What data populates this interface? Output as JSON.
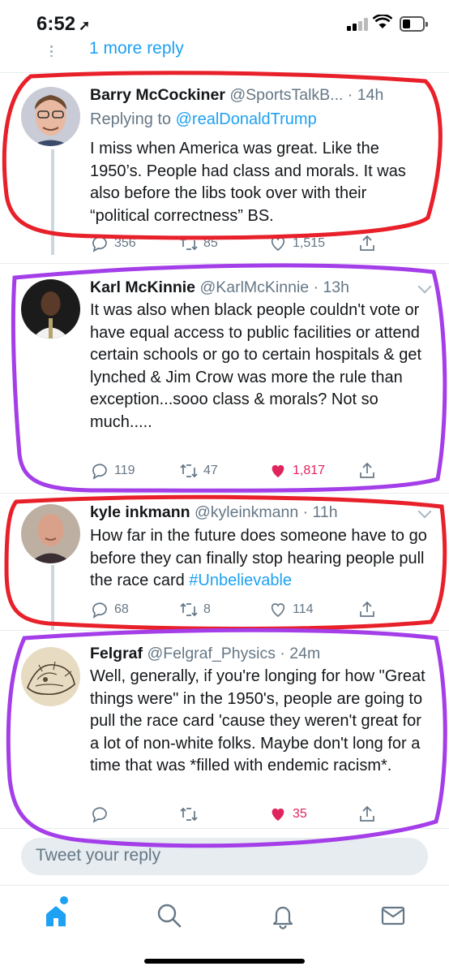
{
  "status_bar": {
    "time": "6:52",
    "location_arrow": "location-arrow-icon"
  },
  "thread": {
    "more_replies": "1 more reply"
  },
  "tweets": [
    {
      "name": "Barry McCockiner",
      "handle": "@SportsTalkB...",
      "time": "· 14h",
      "replying_prefix": "Replying to ",
      "replying_to": "@realDonaldTrump",
      "text": "I miss when America was great. Like the 1950’s. People had class and morals. It was also before the libs took over with their “political correctness” BS.",
      "replies": "356",
      "retweets": "85",
      "likes": "1,515",
      "liked": false
    },
    {
      "name": "Karl McKinnie",
      "handle": "@KarlMcKinnie",
      "time": "· 13h",
      "text": "It was also when black people couldn't vote or have equal access to public facilities or attend certain schools or go to certain hospitals & get lynched & Jim Crow was more the rule than exception...sooo class & morals? Not so much.....",
      "replies": "119",
      "retweets": "47",
      "likes": "1,817",
      "liked": true
    },
    {
      "name": "kyle inkmann",
      "handle": "@kyleinkmann",
      "time": "· 11h",
      "text_before": "How far in the future does someone have to go before they can finally stop hearing people pull the race card ",
      "hashtag": "#Unbelievable",
      "replies": "68",
      "retweets": "8",
      "likes": "114",
      "liked": false
    },
    {
      "name": "Felgraf",
      "handle": "@Felgraf_Physics",
      "time": "· 24m",
      "text": "Well, generally, if you're longing for how \"Great things were\" in the 1950's, people are going to pull the race card 'cause they weren't great for a lot of non-white folks. Maybe don't long for a time that was *filled with endemic racism*.",
      "replies": "",
      "retweets": "",
      "likes": "35",
      "liked": true
    }
  ],
  "compose": {
    "placeholder": "Tweet your reply"
  },
  "tabbar": {
    "tabs": [
      "home-icon",
      "search-icon",
      "notifications-icon",
      "messages-icon"
    ]
  },
  "colors": {
    "accent": "#1da1f2",
    "like_active": "#e0245e",
    "secondary_text": "#657786",
    "annotation_red": "#e8202a",
    "annotation_purple": "#a43ee8"
  }
}
